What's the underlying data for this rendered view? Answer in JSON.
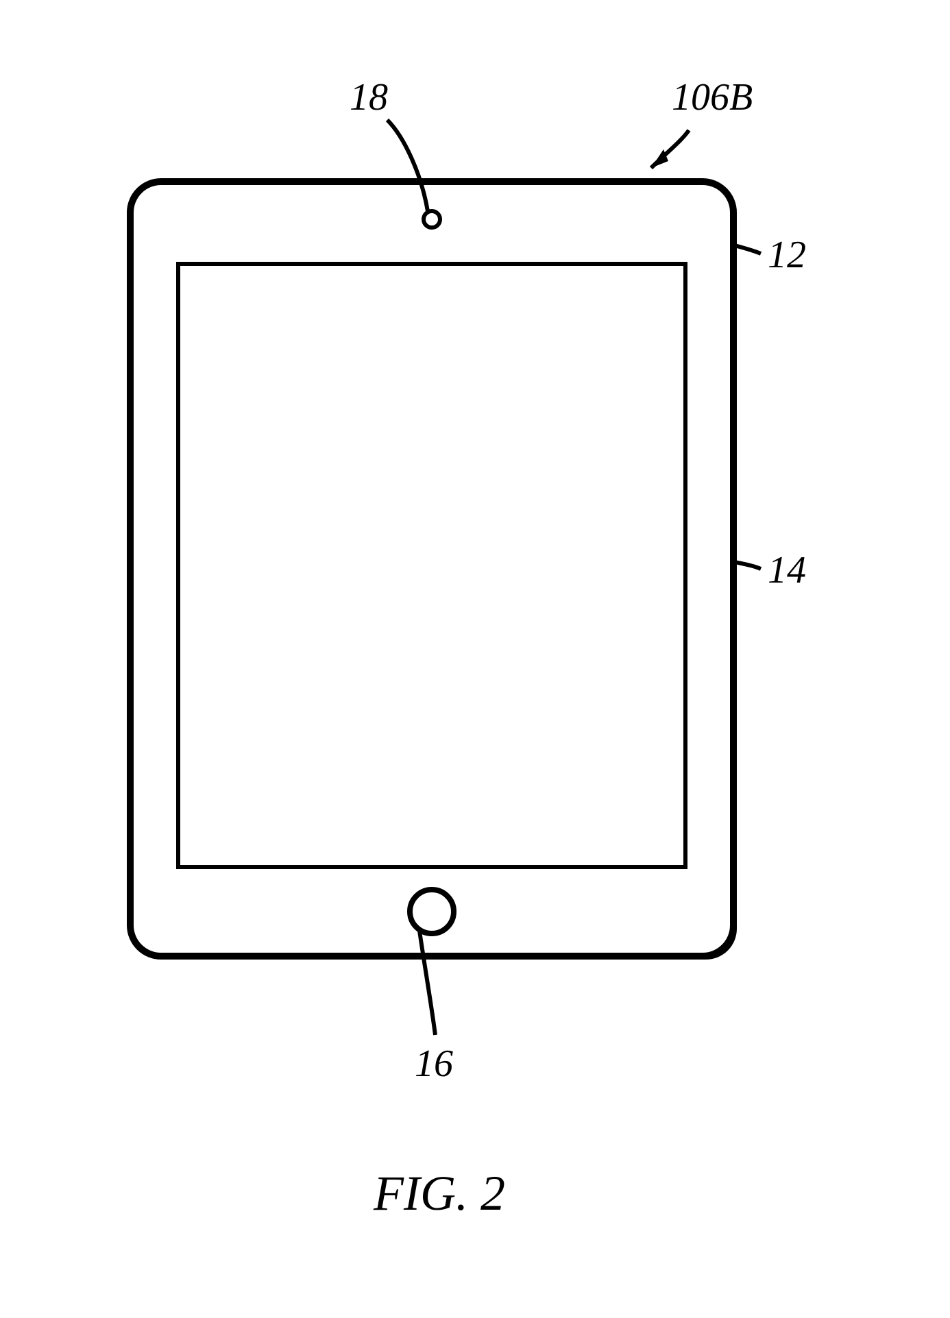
{
  "labels": {
    "ref106B": "106B",
    "ref18": "18",
    "ref12": "12",
    "ref14": "14",
    "ref16": "16"
  },
  "caption": "FIG. 2"
}
